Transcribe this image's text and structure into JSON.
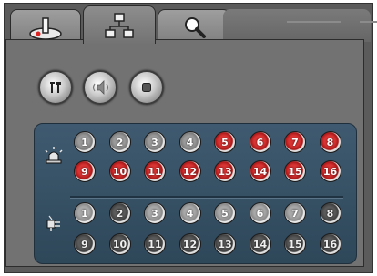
{
  "tabs": [
    {
      "icon": "joystick-icon",
      "active": false
    },
    {
      "icon": "network-icon",
      "active": true
    },
    {
      "icon": "search-icon",
      "active": false
    }
  ],
  "controls": [
    {
      "icon": "tools-icon"
    },
    {
      "icon": "speaker-icon"
    },
    {
      "icon": "stop-icon"
    }
  ],
  "sections": [
    {
      "icon": "alarm-light-icon",
      "row1": [
        "1",
        "2",
        "3",
        "4",
        "5",
        "6",
        "7",
        "8"
      ],
      "row2": [
        "9",
        "10",
        "11",
        "12",
        "13",
        "14",
        "15",
        "16"
      ],
      "row1_states": [
        "gray",
        "gray",
        "gray",
        "gray",
        "red",
        "red",
        "red",
        "red"
      ],
      "row2_states": [
        "red",
        "red",
        "red",
        "red",
        "red",
        "red",
        "red",
        "red"
      ]
    },
    {
      "icon": "relay-plug-icon",
      "row1": [
        "1",
        "2",
        "3",
        "4",
        "5",
        "6",
        "7",
        "8"
      ],
      "row2": [
        "9",
        "10",
        "11",
        "12",
        "13",
        "14",
        "15",
        "16"
      ],
      "row1_states": [
        "light",
        "dark",
        "light",
        "light",
        "light",
        "light",
        "light",
        "dark"
      ],
      "row2_states": [
        "dark",
        "dark",
        "dark",
        "dark",
        "dark",
        "dark",
        "dark",
        "dark"
      ]
    }
  ],
  "colors": {
    "alarm_red": "#c82020",
    "panel_blue": "#35506a",
    "frame_gray": "#5b5b5b"
  }
}
